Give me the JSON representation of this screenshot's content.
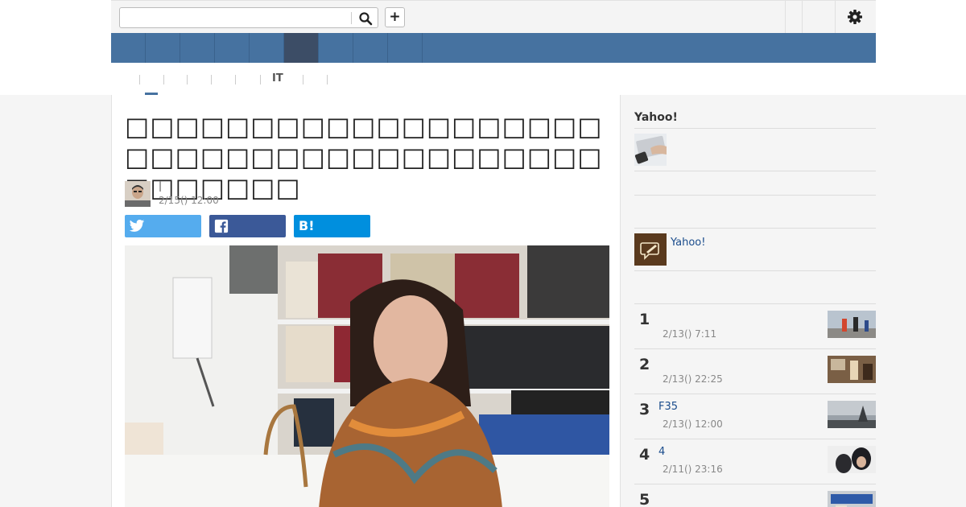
{
  "search": {
    "value": "",
    "placeholder": ""
  },
  "toolbar": {
    "plus_label": "+"
  },
  "subnav": {
    "it_label": "IT"
  },
  "article": {
    "title": "□□□□□□□□□□□□□□□□□□□□□□□□□□□□□□□□□□□□□□□□□□□□□",
    "author": "|",
    "date": "2/15() 12:00"
  },
  "share": {
    "hatena_label": "B!"
  },
  "sidebar": {
    "heading": "Yahoo!",
    "feature_link": "Yahoo!",
    "ranking": [
      {
        "rank": "1",
        "title": "",
        "date": "2/13() 7:11"
      },
      {
        "rank": "2",
        "title": "",
        "date": "2/13() 22:25"
      },
      {
        "rank": "3",
        "title": "F35",
        "date": "2/13() 12:00"
      },
      {
        "rank": "4",
        "title": "4",
        "date": "2/11() 23:16"
      },
      {
        "rank": "5",
        "title": "",
        "date": ""
      }
    ]
  },
  "colors": {
    "nav_bg": "#4672a0",
    "nav_active": "#3c4d66",
    "twitter": "#55acee",
    "facebook": "#3b5998",
    "hatena": "#008fde",
    "link": "#1a4c8c"
  }
}
